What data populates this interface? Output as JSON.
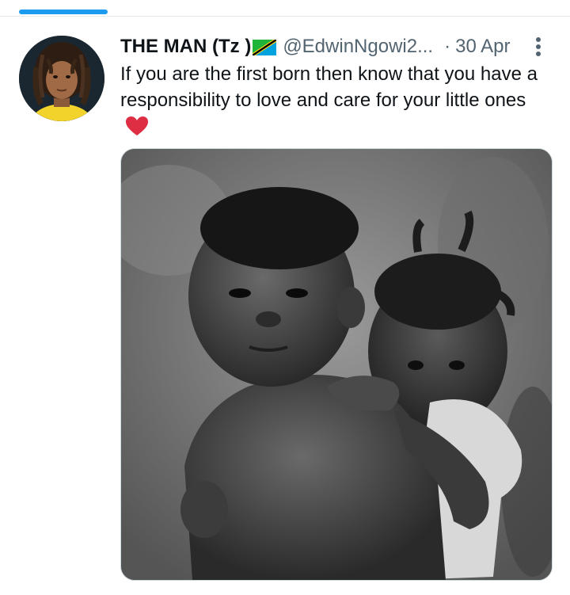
{
  "tweet": {
    "display_name": "THE MAN (Tz )",
    "handle": "@EdwinNgowi2...",
    "separator": "·",
    "date": "30 Apr",
    "text": "If you are the first born then know that you have a responsibility to love and care for your little ones",
    "flag_icon": "tanzania-flag-icon",
    "emoji_icon": "red-heart-icon",
    "media_description_icon": "photo"
  }
}
